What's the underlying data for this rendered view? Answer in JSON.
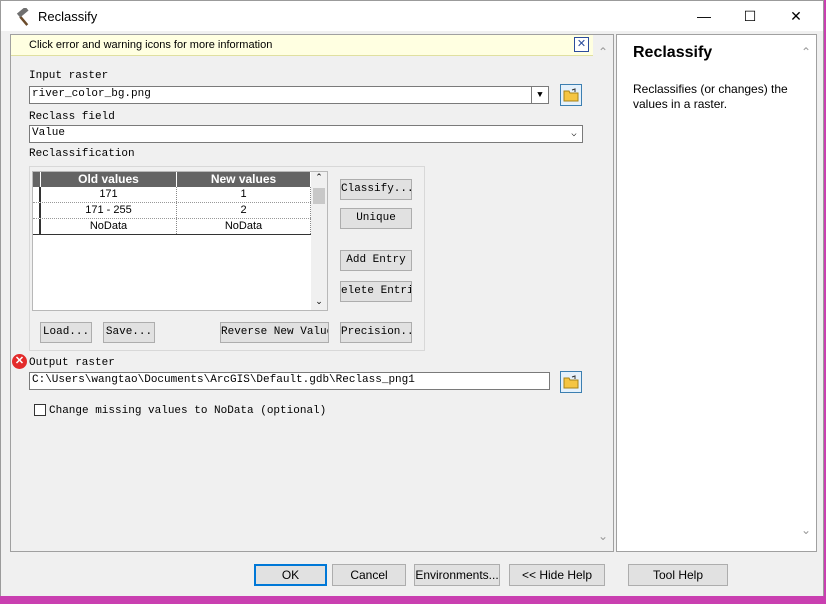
{
  "window": {
    "title": "Reclassify",
    "controls": {
      "minimize": "—",
      "maximize": "☐",
      "close": "✕"
    }
  },
  "info_bar": {
    "text": "Click error and warning icons for more information",
    "close": "✕"
  },
  "form": {
    "input_raster": {
      "label": "Input raster",
      "value": "river_color_bg.png"
    },
    "reclass_field": {
      "label": "Reclass field",
      "value": "Value"
    },
    "reclassification": {
      "label": "Reclassification",
      "columns": [
        "Old values",
        "New values"
      ],
      "rows": [
        {
          "old": "171",
          "new": "1"
        },
        {
          "old": "171 - 255",
          "new": "2"
        },
        {
          "old": "NoData",
          "new": "NoData"
        }
      ],
      "buttons": {
        "classify": "Classify...",
        "unique": "Unique",
        "add_entry": "Add Entry",
        "delete_entries": "elete Entrie",
        "load": "Load...",
        "save": "Save...",
        "reverse": "Reverse New Values",
        "precision": "Precision..."
      }
    },
    "output_raster": {
      "label": "Output raster",
      "value": "C:\\Users\\wangtao\\Documents\\ArcGIS\\Default.gdb\\Reclass_png1"
    },
    "missing_values": {
      "label": "Change missing values to NoData (optional)",
      "checked": false
    }
  },
  "help": {
    "title": "Reclassify",
    "description": "Reclassifies (or changes) the values in a raster."
  },
  "footer": {
    "ok": "OK",
    "cancel": "Cancel",
    "environments": "Environments...",
    "hide_help": "<< Hide Help",
    "tool_help": "Tool Help"
  },
  "colors": {
    "error": "#e32b2b",
    "header": "#646464",
    "info_bg": "#ffffe1",
    "ok_border": "#0078d7"
  }
}
